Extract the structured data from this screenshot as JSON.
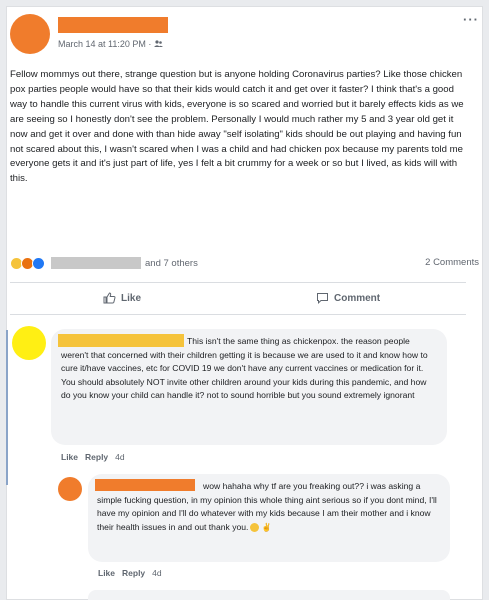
{
  "post": {
    "timestamp": "March 14 at 11:20 PM ·",
    "menu_icon": "more-options-icon",
    "privacy_icon": "friends-icon",
    "text": "Fellow mommys out there, strange question but is anyone holding Coronavirus parties? Like those chicken pox parties people would have so that their kids would catch it and get over it faster? I think that's a good way to handle this current virus with kids, everyone is so scared and worried but it barely effects kids as we are seeing so I honestly don't see the problem. Personally I would much rather my 5 and 3 year old get it now and get it over and done with than hide away \"self isolating\" kids should be out playing and having fun not scared about this, I wasn't scared when I was a child and had chicken pox because my parents told me everyone gets it and it's just part of life, yes I felt a bit crummy for a week or so but I lived, as kids will with this.",
    "reactions_others": "and 7 others",
    "comments_count": "2 Comments",
    "like_label": "Like",
    "comment_label": "Comment"
  },
  "comments": [
    {
      "text": "This isn't the same thing as chickenpox. the reason people weren't that concerned with their children getting it is because we are used to it and know how to cure it/have vaccines, etc for COVID 19 we don't have any current vaccines or medication for it. You should absolutely NOT invite other children around your kids during this pandemic, and how do you know your child can handle it? not to sound horrible but you sound extremely ignorant",
      "like": "Like",
      "reply": "Reply",
      "age": "4d"
    },
    {
      "text": "wow hahaha why tf are you freaking out?? i was asking a simple fucking question, in my opinion this whole thing aint serious so if you dont mind, I'll have my opinion and I'll do whatever with my kids because I am their mother and i know their health issues in and out thank you.",
      "like": "Like",
      "reply": "Reply",
      "age": "4d"
    }
  ],
  "colors": {
    "redaction_orange": "#f07c2c",
    "redaction_yellow": "#ffef14",
    "bubble_bg": "#f2f3f5",
    "page_bg": "#e9ebee"
  }
}
